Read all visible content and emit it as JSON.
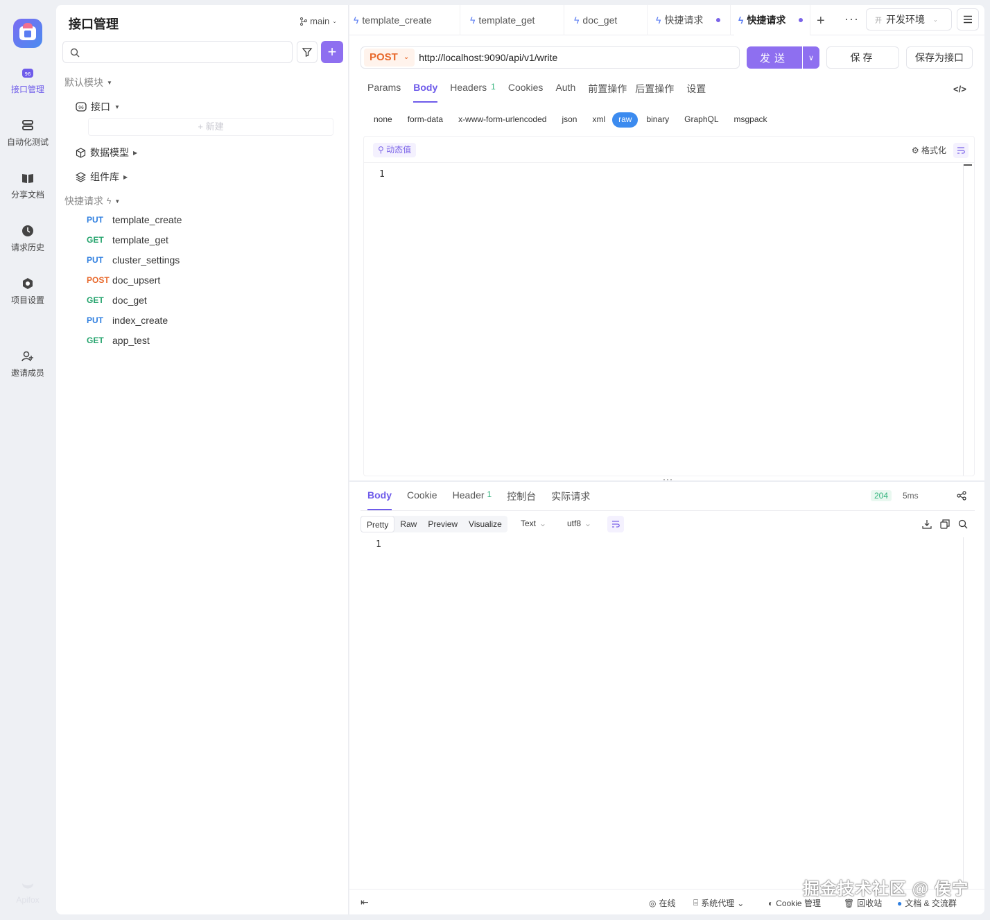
{
  "rail": {
    "items": [
      {
        "label": "接口管理",
        "icon": "api-icon",
        "active": true
      },
      {
        "label": "自动化测试",
        "icon": "automation-icon"
      },
      {
        "label": "分享文档",
        "icon": "book-icon"
      },
      {
        "label": "请求历史",
        "icon": "clock-icon"
      },
      {
        "label": "项目设置",
        "icon": "settings-icon"
      },
      {
        "label": "邀请成员",
        "icon": "add-user-icon"
      }
    ],
    "footer_brand": "Apifox"
  },
  "panel": {
    "title": "接口管理",
    "branch": "main",
    "search_placeholder": "",
    "tree": {
      "default_module": "默认模块",
      "api_label": "接口",
      "new_label": "+ 新建",
      "data_model": "数据模型",
      "components": "组件库",
      "quick_requests": "快捷请求"
    },
    "requests": [
      {
        "method": "PUT",
        "name": "template_create",
        "color": "#2f7fe0"
      },
      {
        "method": "GET",
        "name": "template_get",
        "color": "#23a36c"
      },
      {
        "method": "PUT",
        "name": "cluster_settings",
        "color": "#2f7fe0"
      },
      {
        "method": "POST",
        "name": "doc_upsert",
        "color": "#e8692c"
      },
      {
        "method": "GET",
        "name": "doc_get",
        "color": "#23a36c"
      },
      {
        "method": "PUT",
        "name": "index_create",
        "color": "#2f7fe0"
      },
      {
        "method": "GET",
        "name": "app_test",
        "color": "#23a36c"
      }
    ]
  },
  "tabs": [
    {
      "label": "template_create"
    },
    {
      "label": "template_get"
    },
    {
      "label": "doc_get"
    },
    {
      "label": "快捷请求",
      "dirty": true
    },
    {
      "label": "快捷请求",
      "dirty": true,
      "active": true
    }
  ],
  "env": {
    "badge": "开",
    "label": "开发环境"
  },
  "request": {
    "method": "POST",
    "url": "http://localhost:9090/api/v1/write",
    "send": "发送",
    "save": "保存",
    "save_as": "保存为接口"
  },
  "subtabs": [
    {
      "label": "Params"
    },
    {
      "label": "Body",
      "active": true
    },
    {
      "label": "Headers",
      "count": "1"
    },
    {
      "label": "Cookies"
    },
    {
      "label": "Auth"
    },
    {
      "label": "前置操作"
    },
    {
      "label": "后置操作"
    },
    {
      "label": "设置"
    }
  ],
  "body_types": [
    "none",
    "form-data",
    "x-www-form-urlencoded",
    "json",
    "xml",
    "raw",
    "binary",
    "GraphQL",
    "msgpack"
  ],
  "body_type_active": "raw",
  "editor": {
    "dynamic": "动态值",
    "format": "格式化",
    "line": "1"
  },
  "response": {
    "tabs": [
      {
        "label": "Body",
        "active": true
      },
      {
        "label": "Cookie"
      },
      {
        "label": "Header",
        "count": "1"
      },
      {
        "label": "控制台"
      },
      {
        "label": "实际请求"
      }
    ],
    "status": "204",
    "time": "5ms",
    "views": [
      "Pretty",
      "Raw",
      "Preview",
      "Visualize"
    ],
    "view_active": "Pretty",
    "lang": "Text",
    "encoding": "utf8",
    "line": "1"
  },
  "footer": {
    "online": "在线",
    "proxy": "系统代理",
    "cookie": "Cookie 管理",
    "recycle": "回收站",
    "docs": "文档 & 交流群"
  },
  "watermark": "掘金技术社区 @ 侯宁"
}
